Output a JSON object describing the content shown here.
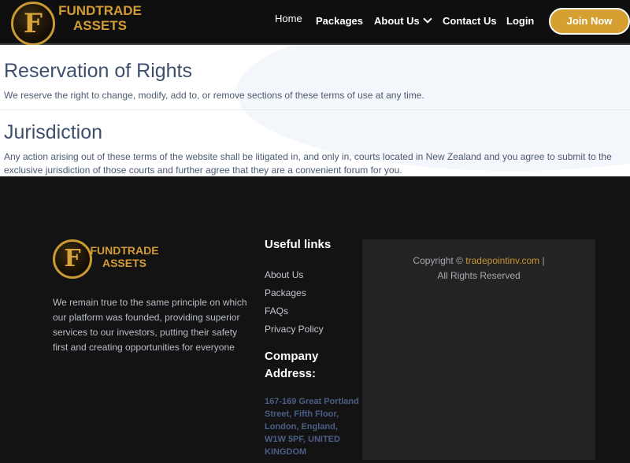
{
  "header": {
    "logo_letter": "F",
    "logo_line1": "FUNDTRADE",
    "logo_line2": "ASSETS",
    "nav": {
      "home": "Home",
      "packages": "Packages",
      "about": "About Us",
      "contact": "Contact Us",
      "login": "Login",
      "join": "Join Now"
    }
  },
  "content": {
    "sections": [
      {
        "title": "Reservation of Rights",
        "text": "We reserve the right to change, modify, add to, or remove sections of these terms of use at any time."
      },
      {
        "title": "Jurisdiction",
        "text": "Any action arising out of these terms of the website shall be litigated in, and only in, courts located in New Zealand and you agree to submit to the exclusive jurisdiction of those courts and further agree that they are a convenient forum for you."
      }
    ]
  },
  "footer": {
    "logo_letter": "F",
    "logo_line1": "FUNDTRADE",
    "logo_line2": "ASSETS",
    "description": "We remain true to the same principle on which our platform was founded, providing superior services to our investors, putting their safety first and creating opportunities for everyone",
    "useful_links_title": "Useful links",
    "links": [
      "About Us",
      "Packages",
      "FAQs",
      "Privacy Policy"
    ],
    "company_title_1": "Company",
    "company_title_2": "Address:",
    "address": "167-169 Great Portland Street, Fifth Floor, London, England, W1W 5PF, UNITED KINGDOM",
    "copyright_prefix": "Copyright ©",
    "copyright_site": "tradepointinv.com",
    "copyright_sep": "|",
    "copyright_suffix": "All Rights Reserved"
  },
  "colors": {
    "header_bg": "#0f0f10",
    "brand_gold": "#d6a030",
    "heading": "#3e4f6c",
    "footer_bg": "#131314"
  },
  "icons": [
    "chevron-down-icon"
  ]
}
